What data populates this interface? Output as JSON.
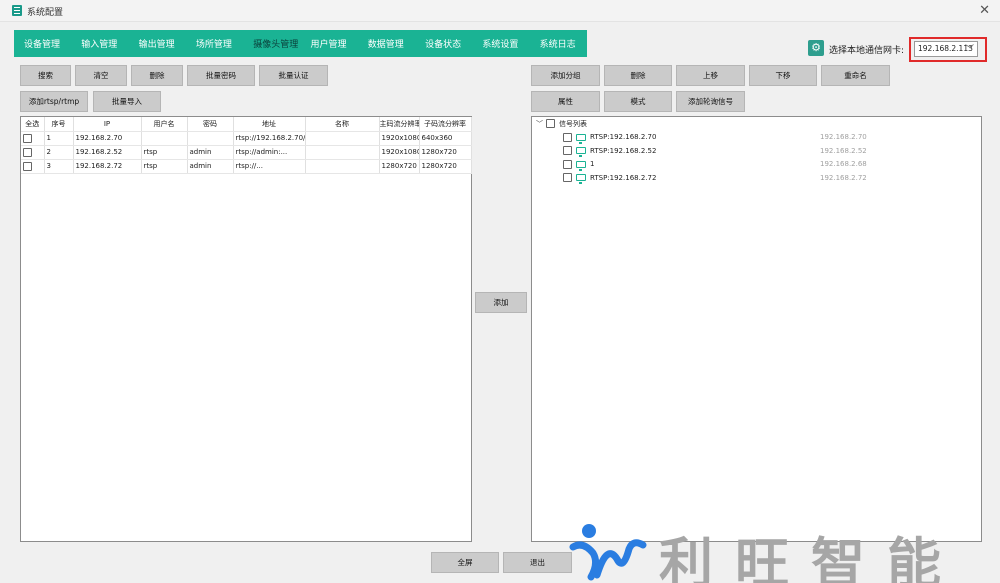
{
  "window": {
    "title": "系统配置"
  },
  "tabs": [
    "设备管理",
    "输入管理",
    "输出管理",
    "场所管理",
    "摄像头管理",
    "用户管理",
    "数据管理",
    "设备状态",
    "系统设置",
    "系统日志"
  ],
  "nic": {
    "label": "选择本地通信网卡:",
    "value": "192.168.2.113"
  },
  "left_toolbar": {
    "search": "搜索",
    "clear": "清空",
    "delete": "删除",
    "batch_password": "批量密码",
    "batch_auth": "批量认证",
    "add_rtsp": "添加rtsp/rtmp",
    "batch_import": "批量导入"
  },
  "camera_table": {
    "headers": [
      "全选",
      "序号",
      "IP",
      "用户名",
      "密码",
      "地址",
      "名称",
      "主码流分辨率",
      "子码流分辨率"
    ],
    "rows": [
      {
        "no": "1",
        "ip": "192.168.2.70",
        "user": "",
        "pwd": "",
        "addr": "rtsp://192.168.2.70/...",
        "name": "",
        "main": "1920x1080",
        "sub": "640x360"
      },
      {
        "no": "2",
        "ip": "192.168.2.52",
        "user": "rtsp",
        "pwd": "admin",
        "addr": "rtsp://admin:...",
        "name": "",
        "main": "1920x1080",
        "sub": "1280x720"
      },
      {
        "no": "3",
        "ip": "192.168.2.72",
        "user": "rtsp",
        "pwd": "admin",
        "addr": "rtsp://...",
        "name": "",
        "main": "1280x720",
        "sub": "1280x720"
      }
    ]
  },
  "middle": {
    "add": "添加"
  },
  "right_toolbar": {
    "add_group": "添加分组",
    "delete": "删除",
    "move_up": "上移",
    "move_down": "下移",
    "rename": "重命名",
    "properties": "属性",
    "mode": "模式",
    "add_poll": "添加轮询信号"
  },
  "signal_tree": {
    "root": "信号列表",
    "items": [
      {
        "label": "RTSP:192.168.2.70",
        "ip": "192.168.2.70"
      },
      {
        "label": "RTSP:192.168.2.52",
        "ip": "192.168.2.52"
      },
      {
        "label": "1",
        "ip": "192.168.2.68"
      },
      {
        "label": "RTSP:192.168.2.72",
        "ip": "192.168.2.72"
      }
    ]
  },
  "footer": {
    "fullscreen": "全屏",
    "exit": "退出"
  },
  "watermark": {
    "text": "利旺智能"
  },
  "colors": {
    "accent": "#1ab394",
    "highlight": "#e02a2a"
  },
  "icons": {
    "app": "grid-app-icon",
    "close": "close-icon",
    "gear": "gear-icon",
    "monitor": "monitor-icon"
  }
}
